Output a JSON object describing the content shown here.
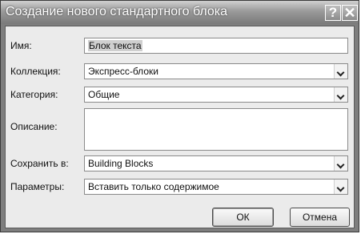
{
  "dialog": {
    "title": "Создание нового стандартного блока",
    "help_glyph": "?",
    "close_glyph": "✕"
  },
  "form": {
    "name": {
      "label": "Имя:",
      "value": "Блок текста"
    },
    "collection": {
      "label": "Коллекция:",
      "value": "Экспресс-блоки"
    },
    "category": {
      "label": "Категория:",
      "value": "Общие"
    },
    "description": {
      "label": "Описание:",
      "value": ""
    },
    "save_in": {
      "label": "Сохранить в:",
      "value": "Building Blocks"
    },
    "options": {
      "label": "Параметры:",
      "value": "Вставить только содержимое"
    }
  },
  "buttons": {
    "ok": "ОК",
    "cancel": "Отмена"
  },
  "icons": [
    "help-icon",
    "close-icon",
    "dropdown-arrow-icon"
  ]
}
